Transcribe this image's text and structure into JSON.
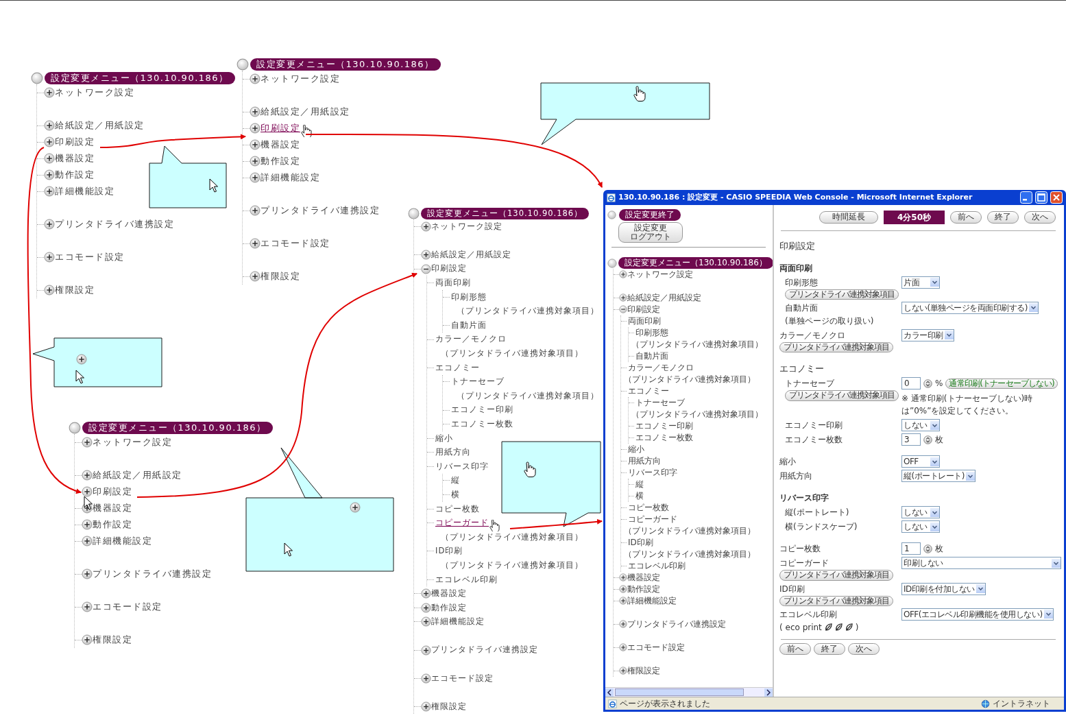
{
  "trees": [
    {
      "title": "設定変更メニュー（130.10.90.186）",
      "groups": [
        [
          {
            "label": "ネットワーク設定",
            "expanded": false,
            "hovered": false
          }
        ],
        [
          {
            "label": "給紙設定／用紙設定",
            "expanded": false,
            "hovered": false
          },
          {
            "label": "印刷設定",
            "expanded": false,
            "hovered": false
          },
          {
            "label": "機器設定",
            "expanded": false,
            "hovered": false
          },
          {
            "label": "動作設定",
            "expanded": false,
            "hovered": false
          },
          {
            "label": "詳細機能設定",
            "expanded": false,
            "hovered": false
          }
        ],
        [
          {
            "label": "プリンタドライバ連携設定",
            "expanded": false,
            "hovered": false
          }
        ],
        [
          {
            "label": "エコモード設定",
            "expanded": false,
            "hovered": false
          }
        ],
        [
          {
            "label": "権限設定",
            "expanded": false,
            "hovered": false
          }
        ]
      ]
    },
    {
      "title": "設定変更メニュー（130.10.90.186）",
      "groups": [
        [
          {
            "label": "ネットワーク設定",
            "expanded": false,
            "hovered": false
          }
        ],
        [
          {
            "label": "給紙設定／用紙設定",
            "expanded": false,
            "hovered": false
          },
          {
            "label": "印刷設定",
            "expanded": false,
            "hovered": true
          },
          {
            "label": "機器設定",
            "expanded": false,
            "hovered": false
          },
          {
            "label": "動作設定",
            "expanded": false,
            "hovered": false
          },
          {
            "label": "詳細機能設定",
            "expanded": false,
            "hovered": false
          }
        ],
        [
          {
            "label": "プリンタドライバ連携設定",
            "expanded": false,
            "hovered": false
          }
        ],
        [
          {
            "label": "エコモード設定",
            "expanded": false,
            "hovered": false
          }
        ],
        [
          {
            "label": "権限設定",
            "expanded": false,
            "hovered": false
          }
        ]
      ]
    },
    {
      "title": "設定変更メニュー（130.10.90.186）",
      "groups": [
        [
          {
            "label": "ネットワーク設定",
            "expanded": false,
            "hovered": false
          }
        ],
        [
          {
            "label": "給紙設定／用紙設定",
            "expanded": false,
            "hovered": false
          },
          {
            "label": "印刷設定",
            "expanded": true,
            "hovered": false,
            "children": [
              {
                "label": "両面印刷",
                "hovered": false,
                "children": [
                  {
                    "label": "印刷形態",
                    "hovered": false,
                    "note": "（プリンタドライバ連携対象項目）"
                  },
                  {
                    "label": "自動片面",
                    "hovered": false
                  }
                ]
              },
              {
                "label": "カラー／モノクロ",
                "hovered": false,
                "note": "（プリンタドライバ連携対象項目）"
              },
              {
                "label": "エコノミー",
                "hovered": false,
                "children": [
                  {
                    "label": "トナーセーブ",
                    "hovered": false,
                    "note": "（プリンタドライバ連携対象項目）"
                  },
                  {
                    "label": "エコノミー印刷",
                    "hovered": false
                  },
                  {
                    "label": "エコノミー枚数",
                    "hovered": false
                  }
                ]
              },
              {
                "label": "縮小",
                "hovered": false
              },
              {
                "label": "用紙方向",
                "hovered": false
              },
              {
                "label": "リバース印字",
                "hovered": false,
                "children": [
                  {
                    "label": "縦",
                    "hovered": false
                  },
                  {
                    "label": "横",
                    "hovered": false
                  }
                ]
              },
              {
                "label": "コピー枚数",
                "hovered": false
              },
              {
                "label": "コピーガード",
                "hovered": true,
                "note": "（プリンタドライバ連携対象項目）"
              },
              {
                "label": "ID印刷",
                "hovered": false,
                "note": "（プリンタドライバ連携対象項目）"
              },
              {
                "label": "エコレベル印刷",
                "hovered": false
              }
            ]
          },
          {
            "label": "機器設定",
            "expanded": false,
            "hovered": false
          },
          {
            "label": "動作設定",
            "expanded": false,
            "hovered": false
          },
          {
            "label": "詳細機能設定",
            "expanded": false,
            "hovered": false
          }
        ],
        [
          {
            "label": "プリンタドライバ連携設定",
            "expanded": false,
            "hovered": false
          }
        ],
        [
          {
            "label": "エコモード設定",
            "expanded": false,
            "hovered": false
          }
        ],
        [
          {
            "label": "権限設定",
            "expanded": false,
            "hovered": false
          }
        ]
      ]
    },
    {
      "title": "設定変更メニュー（130.10.90.186）",
      "groups": [
        [
          {
            "label": "ネットワーク設定",
            "expanded": false,
            "hovered": false
          }
        ],
        [
          {
            "label": "給紙設定／用紙設定",
            "expanded": false,
            "hovered": false
          },
          {
            "label": "印刷設定",
            "expanded": false,
            "hovered": false
          },
          {
            "label": "機器設定",
            "expanded": false,
            "hovered": false
          },
          {
            "label": "動作設定",
            "expanded": false,
            "hovered": false
          },
          {
            "label": "詳細機能設定",
            "expanded": false,
            "hovered": false
          }
        ],
        [
          {
            "label": "プリンタドライバ連携設定",
            "expanded": false,
            "hovered": false
          }
        ],
        [
          {
            "label": "エコモード設定",
            "expanded": false,
            "hovered": false
          }
        ],
        [
          {
            "label": "権限設定",
            "expanded": false,
            "hovered": false
          }
        ]
      ]
    }
  ],
  "browser": {
    "title": "130.10.90.186 : 設定変更 - CASIO SPEEDIA Web Console - Microsoft Internet Explorer",
    "end_label": "設定変更終了",
    "logout_button": [
      "設定変更",
      "ログアウト"
    ],
    "tree": {
      "title": "設定変更メニュー（130.10.90.186）",
      "groups": [
        [
          {
            "label": "ネットワーク設定",
            "expanded": false,
            "hovered": false
          }
        ],
        [
          {
            "label": "給紙設定／用紙設定",
            "expanded": false,
            "hovered": false
          },
          {
            "label": "印刷設定",
            "expanded": true,
            "hovered": false,
            "children": [
              {
                "label": "両面印刷",
                "hovered": false,
                "children": [
                  {
                    "label": "印刷形態",
                    "hovered": false,
                    "note": "（プリンタドライバ連携対象項目）"
                  },
                  {
                    "label": "自動片面",
                    "hovered": false
                  }
                ]
              },
              {
                "label": "カラー／モノクロ",
                "hovered": false,
                "note": "（プリンタドライバ連携対象項目）"
              },
              {
                "label": "エコノミー",
                "hovered": false,
                "children": [
                  {
                    "label": "トナーセーブ",
                    "hovered": false,
                    "note": "（プリンタドライバ連携対象項目）"
                  },
                  {
                    "label": "エコノミー印刷",
                    "hovered": false
                  },
                  {
                    "label": "エコノミー枚数",
                    "hovered": false
                  }
                ]
              },
              {
                "label": "縮小",
                "hovered": false
              },
              {
                "label": "用紙方向",
                "hovered": false
              },
              {
                "label": "リバース印字",
                "hovered": false,
                "children": [
                  {
                    "label": "縦",
                    "hovered": false
                  },
                  {
                    "label": "横",
                    "hovered": false
                  }
                ]
              },
              {
                "label": "コピー枚数",
                "hovered": false
              },
              {
                "label": "コピーガード",
                "hovered": false,
                "note": "（プリンタドライバ連携対象項目）"
              },
              {
                "label": "ID印刷",
                "hovered": false,
                "note": "（プリンタドライバ連携対象項目）"
              },
              {
                "label": "エコレベル印刷",
                "hovered": false
              }
            ]
          },
          {
            "label": "機器設定",
            "expanded": false,
            "hovered": false
          },
          {
            "label": "動作設定",
            "expanded": false,
            "hovered": false
          },
          {
            "label": "詳細機能設定",
            "expanded": false,
            "hovered": false
          }
        ],
        [
          {
            "label": "プリンタドライバ連携設定",
            "expanded": false,
            "hovered": false
          }
        ],
        [
          {
            "label": "エコモード設定",
            "expanded": false,
            "hovered": false
          }
        ],
        [
          {
            "label": "権限設定",
            "expanded": false,
            "hovered": false
          }
        ]
      ]
    },
    "extend_button": "時間延長",
    "timer": "4分50秒",
    "nav_buttons": [
      "前へ",
      "終了",
      "次へ"
    ],
    "heading": "印刷設定",
    "blocks": [
      [
        {
          "kind": "group",
          "label": "両面印刷",
          "rows": [
            {
              "kind": "select",
              "label": "印刷形態",
              "driver_button": "プリンタドライバ連携対象項目",
              "value": "片面",
              "wide": false
            },
            {
              "kind": "select",
              "label": "自動片面",
              "sub": "(単独ページの取り扱い)",
              "value": "しない(単独ページを両面印刷する)",
              "wide": false
            }
          ]
        },
        {
          "kind": "select",
          "label": "カラー／モノクロ",
          "driver_button": "プリンタドライバ連携対象項目",
          "value": "カラー印刷",
          "wide": false
        }
      ],
      [
        {
          "kind": "section",
          "label": "エコノミー",
          "rows": [
            {
              "kind": "spin",
              "label": "トナーセーブ",
              "driver_button": "プリンタドライバ連携対象項目",
              "value": "0",
              "unit": "%",
              "action_button": "通常印刷(トナーセーブしない)",
              "note": "※ 通常印刷(トナーセーブしない)時は”0%”を設定してください。"
            },
            {
              "kind": "select",
              "label": "エコノミー印刷",
              "value": "しない",
              "wide": false
            },
            {
              "kind": "spin",
              "label": "エコノミー枚数",
              "value": "3",
              "unit": "枚"
            }
          ]
        }
      ],
      [
        {
          "kind": "select",
          "label": "縮小",
          "value": "OFF",
          "wide": false
        },
        {
          "kind": "select",
          "label": "用紙方向",
          "value": "縦(ポートレート)",
          "wide": false
        }
      ],
      [
        {
          "kind": "group",
          "label": "リバース印字",
          "rows": [
            {
              "kind": "select",
              "label": "縦(ポートレート)",
              "value": "しない",
              "wide": false
            },
            {
              "kind": "select",
              "label": "横(ランドスケープ)",
              "value": "しない",
              "wide": false
            }
          ]
        }
      ],
      [
        {
          "kind": "spin",
          "label": "コピー枚数",
          "value": "1",
          "unit": "枚"
        },
        {
          "kind": "select",
          "label": "コピーガード",
          "driver_button": "プリンタドライバ連携対象項目",
          "value": "印刷しない",
          "wide": true
        },
        {
          "kind": "select",
          "label": "ID印刷",
          "driver_button": "プリンタドライバ連携対象項目",
          "value": "ID印刷を付加しない",
          "wide": false
        },
        {
          "kind": "select",
          "label": "エコレベル印刷",
          "sub": "( eco print",
          "sub_end": ")",
          "value": "OFF(エコレベル印刷機能を使用しない)",
          "wide": false
        }
      ]
    ],
    "footer_buttons": [
      "前へ",
      "終了",
      "次へ"
    ],
    "status": "ページが表示されました",
    "zone": "イントラネット"
  }
}
